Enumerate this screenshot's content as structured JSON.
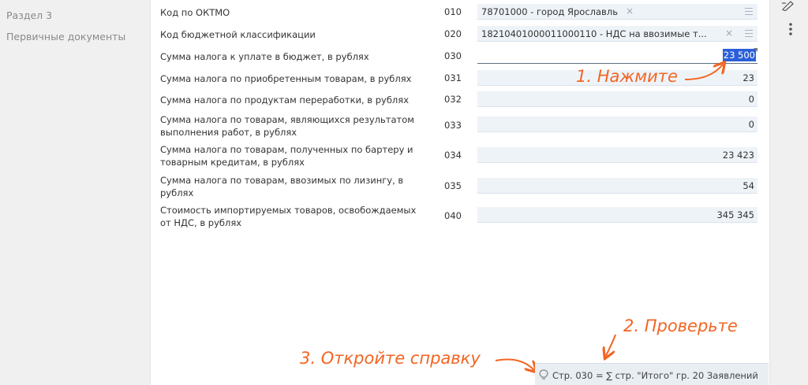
{
  "sidebar": {
    "items": [
      {
        "label": "Раздел 3"
      },
      {
        "label": "Первичные документы"
      }
    ]
  },
  "rows": [
    {
      "label": "Код по ОКТМО",
      "code": "010",
      "value": "78701000 - город Ярославль"
    },
    {
      "label": "Код бюджетной классификации",
      "code": "020",
      "value": "18210401000011000110 - НДС на ввозимые т..."
    },
    {
      "label": "Сумма налога к уплате в бюджет, в рублях",
      "code": "030",
      "value": "23 500"
    },
    {
      "label": "Сумма налога по приобретенным товарам, в рублях",
      "code": "031",
      "value": "23"
    },
    {
      "label": "Сумма налога по продуктам переработки, в рублях",
      "code": "032",
      "value": "0"
    },
    {
      "label": "Сумма налога по товарам, являющихся результатом выполнения работ, в рублях",
      "code": "033",
      "value": "0"
    },
    {
      "label": "Сумма налога по товарам, полученных по бартеру и товарным кредитам, в рублях",
      "code": "034",
      "value": "23 423"
    },
    {
      "label": "Сумма налога по товарам, ввозимых по лизингу, в рублях",
      "code": "035",
      "value": "54"
    },
    {
      "label": "Стоимость импортируемых товаров, освобождаемых от НДС, в рублях",
      "code": "040",
      "value": "345 345"
    }
  ],
  "annotations": {
    "step1": "1. Нажмите",
    "step2": "2. Проверьте",
    "step3": "3. Откройте справку"
  },
  "hint": {
    "text": "Стр. 030 = ∑ стр. \"Итого\" гр. 20 Заявлений"
  },
  "colors": {
    "annotation": "#f26522",
    "selection": "#2b5fd9",
    "field_bg": "#eef3f8"
  },
  "icons": {
    "top_right": "edit-icon",
    "more": "more-vertical-icon",
    "hint": "lightbulb-icon"
  }
}
